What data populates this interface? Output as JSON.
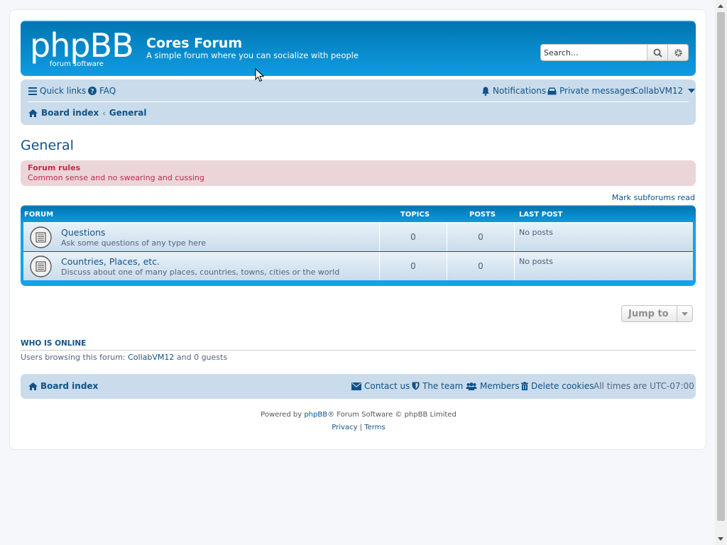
{
  "header": {
    "logo_text": "phpBB",
    "logo_sub": "forum software",
    "site_title": "Cores Forum",
    "site_description": "A simple forum where you can socialize with people",
    "search_placeholder": "Search…"
  },
  "navbar": {
    "quick_links": "Quick links",
    "faq": "FAQ",
    "notifications": "Notifications",
    "private_messages": "Private messages",
    "username": "CollabVM12",
    "breadcrumbs": [
      "Board index",
      "General"
    ]
  },
  "page": {
    "title": "General",
    "rules_title": "Forum rules",
    "rules_text": "Common sense and no swearing and cussing",
    "mark_read": "Mark subforums read"
  },
  "forum_table": {
    "headers": {
      "forum": "Forum",
      "topics": "Topics",
      "posts": "Posts",
      "last_post": "Last post"
    },
    "rows": [
      {
        "name": "Questions",
        "description": "Ask some questions of any type here",
        "topics": "0",
        "posts": "0",
        "last_post": "No posts"
      },
      {
        "name": "Countries, Places, etc.",
        "description": "Discuss about one of many places, countries, towns, cities or the world",
        "topics": "0",
        "posts": "0",
        "last_post": "No posts"
      }
    ]
  },
  "jump_to": "Jump to",
  "who_is_online": {
    "heading": "Who is online",
    "prefix": "Users browsing this forum: ",
    "user": "CollabVM12",
    "suffix": " and 0 guests"
  },
  "footer_nav": {
    "board_index": "Board index",
    "contact_us": "Contact us",
    "the_team": "The team",
    "members": "Members",
    "delete_cookies": "Delete cookies",
    "timezone": "All times are UTC-07:00"
  },
  "copyright": {
    "powered_prefix": "Powered by ",
    "phpbb_link": "phpBB",
    "powered_suffix": "® Forum Software © phpBB Limited",
    "privacy": "Privacy",
    "separator": " | ",
    "terms": "Terms"
  },
  "colors": {
    "header_blue": "#12a3eb",
    "nav_bg": "#cadceb",
    "link": "#105289",
    "rules_bg": "#ecd5d8",
    "rules_text": "#bc2a4d"
  }
}
